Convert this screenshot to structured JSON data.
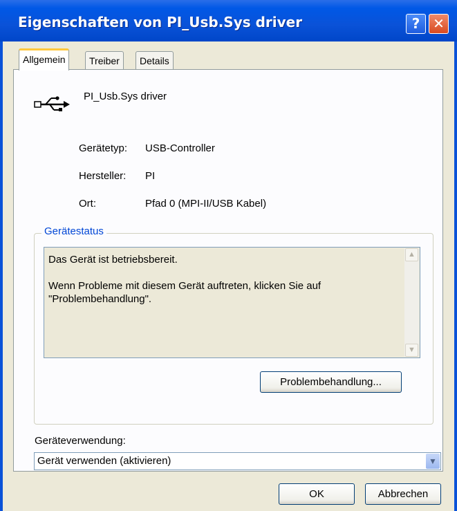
{
  "window": {
    "title": "Eigenschaften von PI_Usb.Sys driver",
    "help_button": "?",
    "close_button": "✕"
  },
  "tabs": [
    {
      "label": "Allgemein",
      "active": true
    },
    {
      "label": "Treiber",
      "active": false
    },
    {
      "label": "Details",
      "active": false
    }
  ],
  "device": {
    "icon": "usb-icon",
    "name": "PI_Usb.Sys driver",
    "properties": [
      {
        "label": "Gerätetyp:",
        "value": "USB-Controller"
      },
      {
        "label": "Hersteller:",
        "value": "PI"
      },
      {
        "label": "Ort:",
        "value": "Pfad 0 (MPI-II/USB Kabel)"
      }
    ]
  },
  "status": {
    "group_label": "Gerätestatus",
    "text": "Das Gerät ist betriebsbereit.\n\nWenn Probleme mit diesem Gerät auftreten, klicken Sie auf \"Problembehandlung\".",
    "troubleshoot_button": "Problembehandlung..."
  },
  "usage": {
    "label": "Geräteverwendung:",
    "selected": "Gerät verwenden (aktivieren)"
  },
  "footer": {
    "ok": "OK",
    "cancel": "Abbrechen"
  }
}
